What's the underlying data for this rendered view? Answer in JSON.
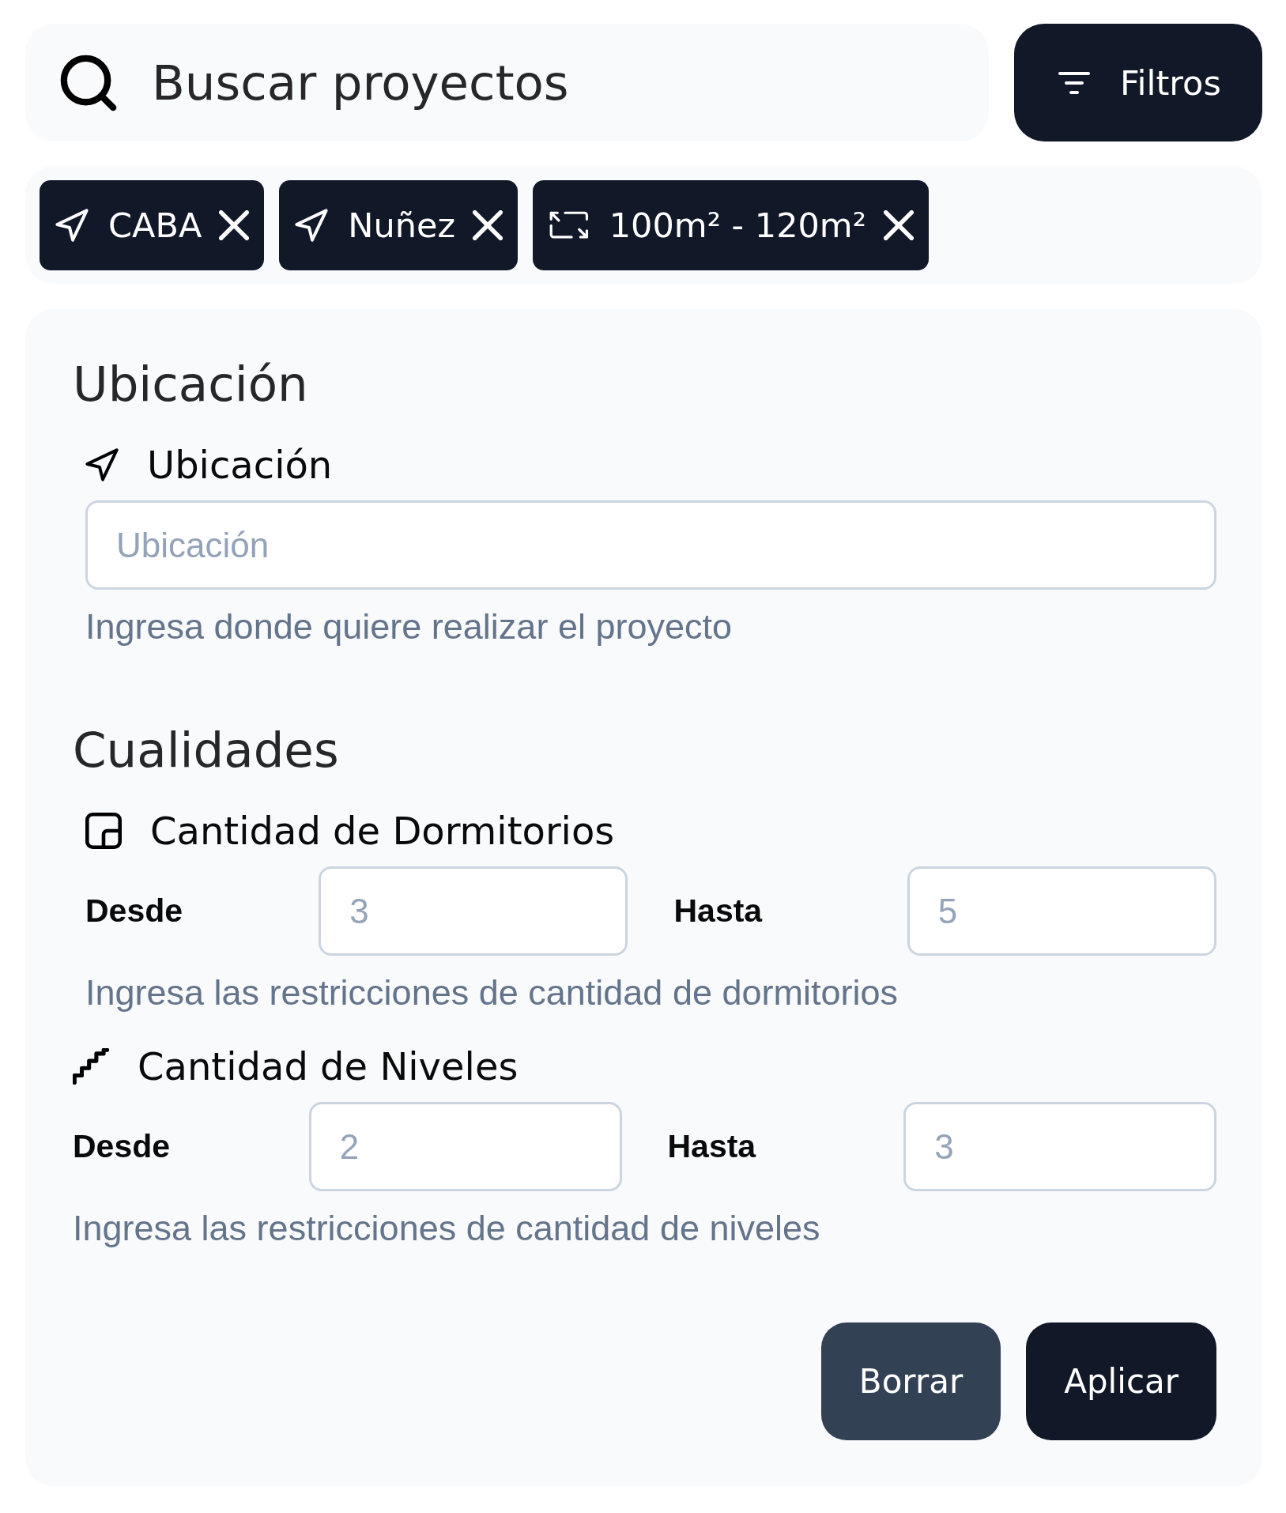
{
  "search": {
    "placeholder": "Buscar proyectos"
  },
  "filters_button": {
    "label": "Filtros"
  },
  "active_filters": [
    {
      "kind": "location",
      "label": "CABA"
    },
    {
      "kind": "location",
      "label": "Nuñez"
    },
    {
      "kind": "area",
      "label": "100m² - 120m²"
    }
  ],
  "sections": [
    {
      "title": "Ubicación",
      "groups": [
        {
          "kind": "location",
          "label": "Ubicación",
          "input": {
            "placeholder": "Ubicación"
          },
          "hint": "Ingresa donde quiere realizar el proyecto"
        }
      ]
    },
    {
      "title": "Cualidades",
      "groups": [
        {
          "kind": "bedrooms",
          "label": "Cantidad de Dormitorios",
          "from": {
            "label": "Desde",
            "placeholder": "3"
          },
          "to": {
            "label": "Hasta",
            "placeholder": "5"
          },
          "hint": "Ingresa las restricciones de cantidad de dormitorios"
        },
        {
          "kind": "levels",
          "label": "Cantidad de Niveles",
          "from": {
            "label": "Desde",
            "placeholder": "2"
          },
          "to": {
            "label": "Hasta",
            "placeholder": "3"
          },
          "hint": "Ingresa las restricciones de cantidad de niveles"
        }
      ]
    }
  ],
  "actions": [
    {
      "kind": "secondary",
      "label": "Borrar"
    },
    {
      "kind": "primary",
      "label": "Aplicar"
    }
  ]
}
